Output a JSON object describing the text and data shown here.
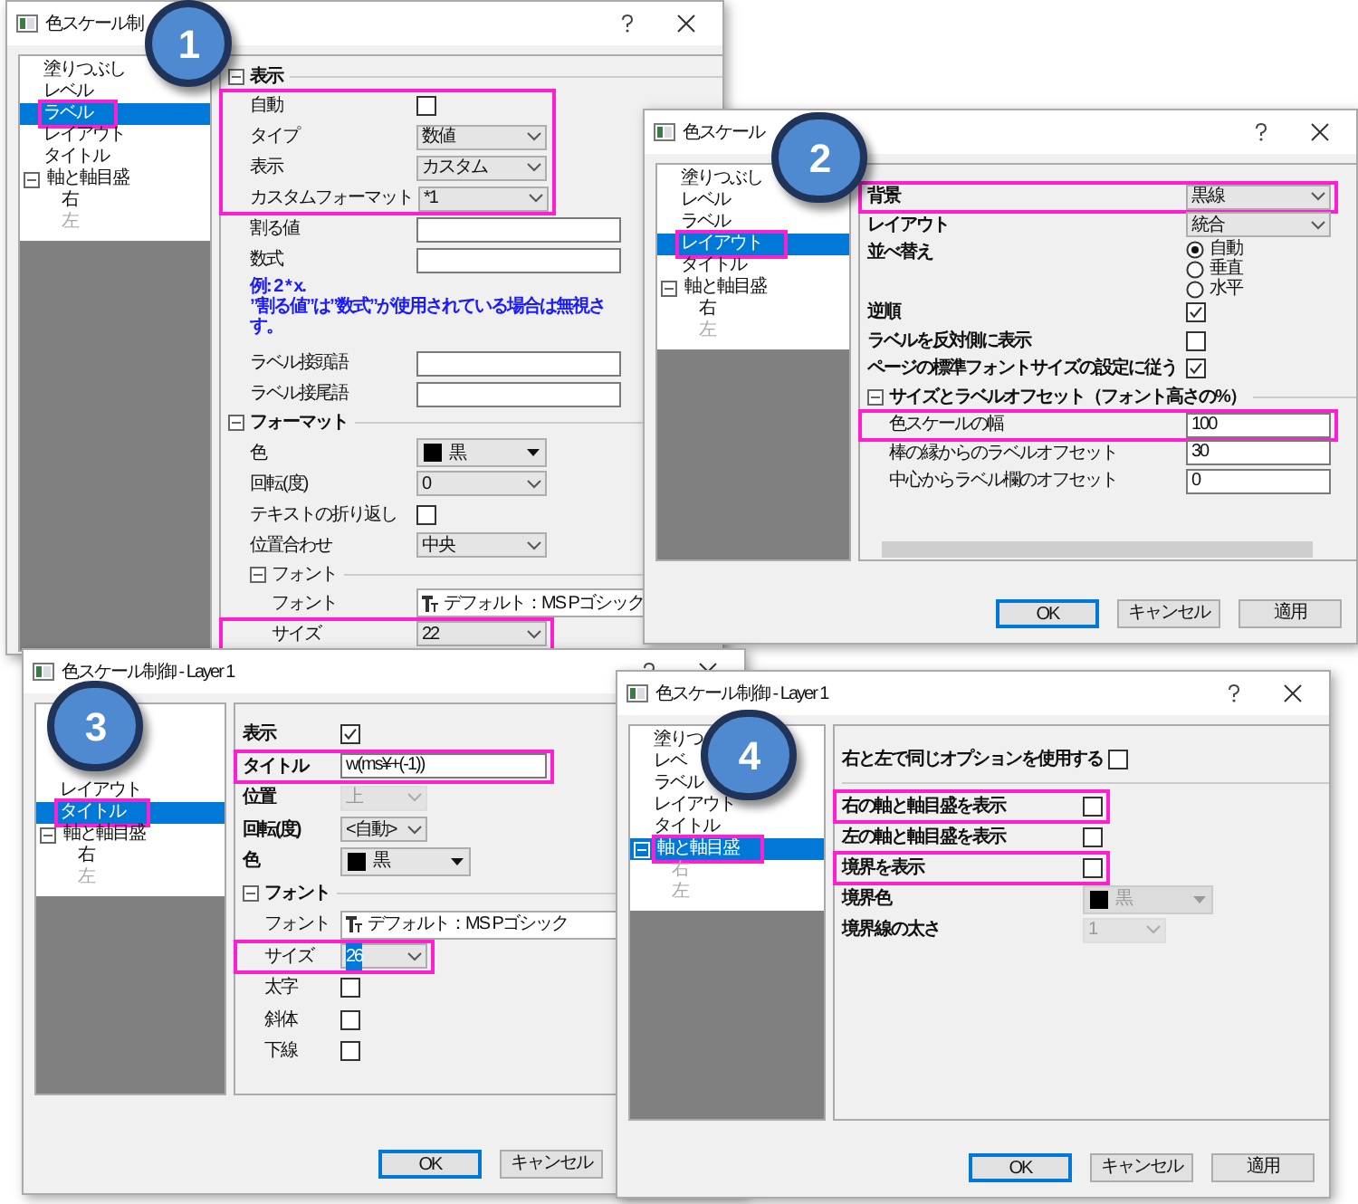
{
  "dialogs": [
    {
      "title": "色スケール制",
      "badge": "1",
      "tree": [
        {
          "label": "塗りつぶし",
          "selected": false,
          "highlighted": false
        },
        {
          "label": "レベル",
          "selected": false,
          "highlighted": false
        },
        {
          "label": "ラベル",
          "selected": true,
          "highlighted": true
        },
        {
          "label": "レイアウト",
          "selected": false,
          "highlighted": false
        },
        {
          "label": "タイトル",
          "selected": false,
          "highlighted": false
        },
        {
          "label": "軸と軸目盛",
          "selected": false,
          "highlighted": false,
          "expanded": true,
          "children": [
            {
              "label": "右",
              "selected": false,
              "disabled": false
            },
            {
              "label": "左",
              "selected": false,
              "disabled": true
            }
          ]
        }
      ],
      "rows": [
        {
          "kind": "section",
          "label": "表示",
          "expanded": true,
          "children": [
            {
              "kind": "group",
              "highlighted": true,
              "rows": [
                {
                  "kind": "checkbox",
                  "label": "自動",
                  "checked": false
                },
                {
                  "kind": "dropdown",
                  "label": "タイプ",
                  "value": "数値",
                  "disabled": false
                },
                {
                  "kind": "dropdown",
                  "label": "表示",
                  "value": "カスタム",
                  "disabled": false
                },
                {
                  "kind": "dropdown",
                  "label": "カスタムフォーマット",
                  "value": "*1",
                  "disabled": false
                }
              ]
            },
            {
              "kind": "input",
              "label": "割る値"
            },
            {
              "kind": "input",
              "label": "数式"
            },
            {
              "kind": "note",
              "lines": [
                "例: 2 * x.",
                "”割る値”は”数式”が使用されている場合は無視さ",
                "す。"
              ]
            },
            {
              "kind": "input",
              "label": "ラベル接頭語"
            },
            {
              "kind": "input",
              "label": "ラベル接尾語"
            }
          ]
        },
        {
          "kind": "section",
          "label": "フォーマット",
          "expanded": true,
          "children": [
            {
              "kind": "color",
              "label": "色",
              "value": "黒",
              "disabled": false
            },
            {
              "kind": "dropdown",
              "label": "回転(度)",
              "value": "0",
              "disabled": false
            },
            {
              "kind": "checkbox",
              "label": "テキストの折り返し",
              "checked": false
            },
            {
              "kind": "dropdown",
              "label": "位置合わせ",
              "value": "中央",
              "disabled": false
            },
            {
              "kind": "section",
              "label": "フォント",
              "expanded": true,
              "children": [
                {
                  "kind": "font",
                  "label": "フォント",
                  "value": "デフォルト：MS Pゴシック"
                },
                {
                  "kind": "group",
                  "highlighted": true,
                  "rows": [
                    {
                      "kind": "dropdown",
                      "label": "サイズ",
                      "value": "22",
                      "disabled": false
                    }
                  ]
                }
              ]
            }
          ]
        }
      ]
    },
    {
      "title": "色スケール",
      "badge": "2",
      "tree": [
        {
          "label": "塗りつぶし",
          "selected": false,
          "highlighted": false
        },
        {
          "label": "レベル",
          "selected": false,
          "highlighted": false
        },
        {
          "label": "ラベル",
          "selected": false,
          "highlighted": false
        },
        {
          "label": "レイアウト",
          "selected": true,
          "highlighted": true
        },
        {
          "label": "タイトル",
          "selected": false,
          "highlighted": false
        },
        {
          "label": "軸と軸目盛",
          "selected": false,
          "highlighted": false,
          "expanded": true,
          "children": [
            {
              "label": "右",
              "selected": false,
              "disabled": false
            },
            {
              "label": "左",
              "selected": false,
              "disabled": true
            }
          ]
        }
      ],
      "rows": [
        {
          "kind": "group",
          "highlighted": true,
          "rows": [
            {
              "kind": "dropdown",
              "label": "背景",
              "value": "黒線",
              "disabled": false
            }
          ]
        },
        {
          "kind": "dropdown",
          "label": "レイアウト",
          "value": "統合",
          "disabled": false
        },
        {
          "kind": "radio",
          "label": "並べ替え",
          "options": [
            {
              "label": "自動",
              "selected": true
            },
            {
              "label": "垂直",
              "selected": false
            },
            {
              "label": "水平",
              "selected": false
            }
          ]
        },
        {
          "kind": "checkbox",
          "label": "逆順",
          "checked": true
        },
        {
          "kind": "checkbox",
          "label": "ラベルを反対側に表示",
          "checked": false
        },
        {
          "kind": "checkbox",
          "label": "ページの標準フォントサイズの設定に従う",
          "checked": true
        },
        {
          "kind": "section",
          "label": "サイズとラベルオフセット（フォント高さの%）",
          "expanded": true,
          "children": [
            {
              "kind": "group",
              "highlighted": true,
              "rows": [
                {
                  "kind": "input",
                  "label": "色スケールの幅",
                  "value": "100"
                }
              ]
            },
            {
              "kind": "input",
              "label": "棒の縁からのラベルオフセット",
              "value": "30"
            },
            {
              "kind": "input",
              "label": "中心からラベル欄のオフセット",
              "value": "0"
            }
          ]
        }
      ],
      "buttons": [
        {
          "label": "OK",
          "default": true
        },
        {
          "label": "キャンセル",
          "default": false
        },
        {
          "label": "適用",
          "default": false
        }
      ]
    },
    {
      "title": "色スケール制御 - Layer 1",
      "badge": "3",
      "tree": [
        {
          "label": "レイアウト",
          "selected": false,
          "highlighted": false
        },
        {
          "label": "タイトル",
          "selected": true,
          "highlighted": true
        },
        {
          "label": "軸と軸目盛",
          "selected": false,
          "highlighted": false,
          "expanded": true,
          "children": [
            {
              "label": "右",
              "selected": false,
              "disabled": false
            },
            {
              "label": "左",
              "selected": false,
              "disabled": true
            }
          ]
        }
      ],
      "rows": [
        {
          "kind": "checkbox",
          "label": "表示",
          "checked": true
        },
        {
          "kind": "group",
          "highlighted": true,
          "rows": [
            {
              "kind": "input",
              "label": "タイトル",
              "value": "w(ms¥+(-1))"
            }
          ]
        },
        {
          "kind": "dropdown",
          "label": "位置",
          "value": "上",
          "disabled": true
        },
        {
          "kind": "dropdown",
          "label": "回転(度)",
          "value": "<自動>",
          "disabled": false
        },
        {
          "kind": "color",
          "label": "色",
          "value": "黒",
          "disabled": false
        },
        {
          "kind": "section",
          "label": "フォント",
          "expanded": true,
          "children": [
            {
              "kind": "font",
              "label": "フォント",
              "value": "デフォルト：MS Pゴシック"
            },
            {
              "kind": "group",
              "highlighted": true,
              "rows": [
                {
                  "kind": "dropdown",
                  "label": "サイズ",
                  "value": "26",
                  "disabled": false,
                  "text_selected": true
                }
              ]
            },
            {
              "kind": "checkbox",
              "label": "太字",
              "checked": false
            },
            {
              "kind": "checkbox",
              "label": "斜体",
              "checked": false
            },
            {
              "kind": "checkbox",
              "label": "下線",
              "checked": false
            }
          ]
        }
      ],
      "buttons": [
        {
          "label": "OK",
          "default": true
        },
        {
          "label": "キャンセル",
          "default": false
        }
      ]
    },
    {
      "title": "色スケール制御 - Layer 1",
      "badge": "4",
      "tree": [
        {
          "label": "塗りつ",
          "selected": false,
          "highlighted": false
        },
        {
          "label": "レベ",
          "selected": false,
          "highlighted": false
        },
        {
          "label": "ラベル",
          "selected": false,
          "highlighted": false
        },
        {
          "label": "レイアウト",
          "selected": false,
          "highlighted": false
        },
        {
          "label": "タイトル",
          "selected": false,
          "highlighted": false
        },
        {
          "label": "軸と軸目盛",
          "selected": true,
          "highlighted": true,
          "expanded": true,
          "children": [
            {
              "label": "右",
              "selected": false,
              "disabled": true
            },
            {
              "label": "左",
              "selected": false,
              "disabled": true
            }
          ]
        }
      ],
      "rows": [
        {
          "kind": "checkbox",
          "label": "右と左で同じオプションを使用する",
          "checked": false
        },
        {
          "kind": "rule"
        },
        {
          "kind": "group",
          "highlighted": true,
          "rows": [
            {
              "kind": "checkbox",
              "label": "右の軸と軸目盛を表示",
              "checked": false
            }
          ]
        },
        {
          "kind": "checkbox",
          "label": "左の軸と軸目盛を表示",
          "checked": false
        },
        {
          "kind": "group",
          "highlighted": true,
          "rows": [
            {
              "kind": "checkbox",
              "label": "境界を表示",
              "checked": false
            }
          ]
        },
        {
          "kind": "color",
          "label": "境界色",
          "value": "黒",
          "disabled": true
        },
        {
          "kind": "dropdown",
          "label": "境界線の太さ",
          "value": "1",
          "disabled": true
        }
      ],
      "buttons": [
        {
          "label": "OK",
          "default": true
        },
        {
          "label": "キャンセル",
          "default": false
        },
        {
          "label": "適用",
          "default": false
        }
      ]
    }
  ]
}
